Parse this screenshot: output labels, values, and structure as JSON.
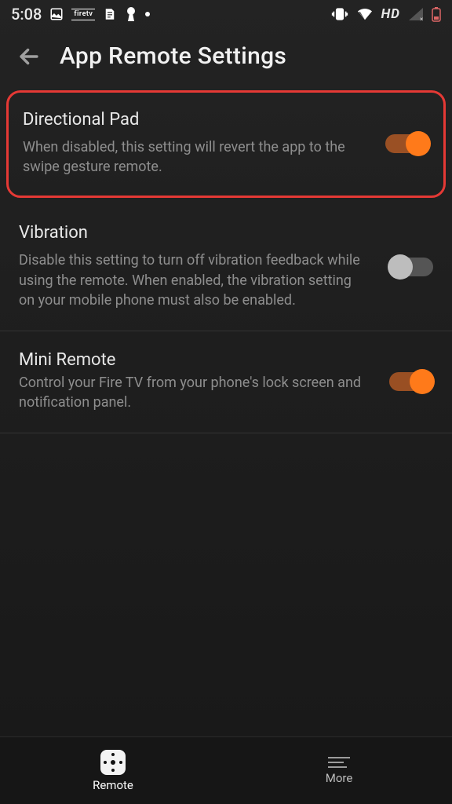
{
  "status": {
    "time": "5:08",
    "hd_label": "HD",
    "firetv_label": "firetv"
  },
  "header": {
    "title": "App Remote Settings"
  },
  "settings": [
    {
      "key": "directional_pad",
      "label": "Directional Pad",
      "description": "When disabled, this setting will revert the app to the swipe gesture remote.",
      "enabled": true,
      "highlighted": true
    },
    {
      "key": "vibration",
      "label": "Vibration",
      "description": "Disable this setting to turn off vibration feedback while using the remote. When enabled, the vibration setting on your mobile phone must also be enabled.",
      "enabled": false,
      "highlighted": false
    },
    {
      "key": "mini_remote",
      "label": "Mini Remote",
      "description": "Control your Fire TV from your phone's lock screen and notification panel.",
      "enabled": true,
      "highlighted": false
    }
  ],
  "nav": {
    "remote": "Remote",
    "more": "More"
  },
  "colors": {
    "accent": "#ff7a1a",
    "highlight_border": "#e53935"
  }
}
